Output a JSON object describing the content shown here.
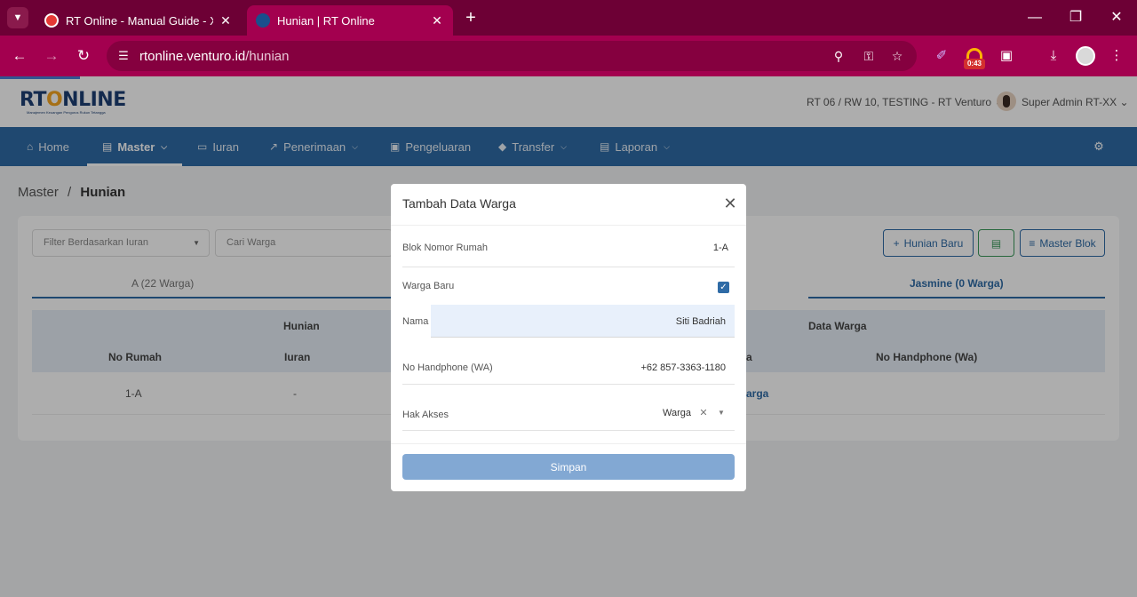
{
  "browser": {
    "tabs": [
      {
        "title": "RT Online - Manual Guide - Xmi",
        "active": false
      },
      {
        "title": "Hunian | RT Online",
        "active": true
      }
    ],
    "url_domain": "rtonline.venturo.id",
    "url_path": "/hunian",
    "extension_timer": "0:43"
  },
  "app": {
    "logo_rt": "RT",
    "logo_o": "O",
    "logo_rest": "NLINE",
    "logo_tagline": "Manajemen Keuangan Pengurus Rukun Tetangga",
    "rt_selector": "RT 06 / RW 10, TESTING - RT Venturo",
    "user_name": "Super Admin RT-XX"
  },
  "nav": {
    "items": [
      {
        "label": "Home",
        "icon": "home-icon"
      },
      {
        "label": "Master",
        "icon": "document-icon",
        "dropdown": true,
        "active": true
      },
      {
        "label": "Iuran",
        "icon": "card-icon"
      },
      {
        "label": "Penerimaan",
        "icon": "chart-icon",
        "dropdown": true
      },
      {
        "label": "Pengeluaran",
        "icon": "image-icon"
      },
      {
        "label": "Transfer",
        "icon": "tag-icon",
        "dropdown": true
      },
      {
        "label": "Laporan",
        "icon": "file-icon",
        "dropdown": true
      }
    ]
  },
  "breadcrumb": {
    "parent": "Master",
    "sep": "/",
    "current": "Hunian"
  },
  "filters": {
    "iuran_placeholder": "Filter Berdasarkan Iuran",
    "search_placeholder": "Cari Warga"
  },
  "actions": {
    "hunian_baru": "Hunian Baru",
    "master_blok": "Master Blok"
  },
  "blok_tabs": [
    {
      "label": "A (22 Warga)",
      "active": false
    },
    {
      "label": "Jasmine (0 Warga)",
      "active": true
    }
  ],
  "table": {
    "group_hunian": "Hunian",
    "group_data_warga": "Data Warga",
    "col_no_rumah": "No Rumah",
    "col_iuran": "Iuran",
    "col_nama_partial": "a",
    "col_no_hp": "No Handphone (Wa)",
    "rows": [
      {
        "no_rumah": "1-A",
        "iuran": "-",
        "warga_partial": "arga"
      }
    ]
  },
  "modal": {
    "title": "Tambah Data Warga",
    "fields": {
      "blok_label": "Blok Nomor Rumah",
      "blok_value": "1-A",
      "warga_baru_label": "Warga Baru",
      "warga_baru_checked": true,
      "nama_label": "Nama",
      "nama_value": "Siti Badriah",
      "hp_label": "No Handphone (WA)",
      "hp_value": "+62 857-3363-1180",
      "akses_label": "Hak Akses",
      "akses_value": "Warga"
    },
    "submit_label": "Simpan"
  },
  "colors": {
    "chrome_dark": "#6d0035",
    "chrome_toolbar": "#a3004f",
    "nav_blue": "#2f6ba6",
    "submit_blue": "#82a8d3"
  }
}
